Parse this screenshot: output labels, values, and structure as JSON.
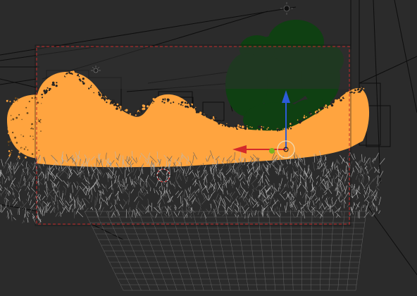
{
  "editor": "3d-viewport",
  "view": "camera-view",
  "scene": {
    "selected_object": "shrub-cards",
    "selection_color": "#ffa43f",
    "background_tree_color": "#0f4012",
    "viewport_background": "#2b2b2b",
    "camera_border_color": "#c42a2a"
  },
  "gizmo": {
    "mode": "translate",
    "axis_colors": {
      "x": "#d42a2a",
      "y": "#7bb31e",
      "z": "#2c5bd8"
    }
  },
  "icons": {
    "light": "light-icon",
    "cursor": "3d-cursor-icon",
    "origin": "object-origin-icon"
  }
}
